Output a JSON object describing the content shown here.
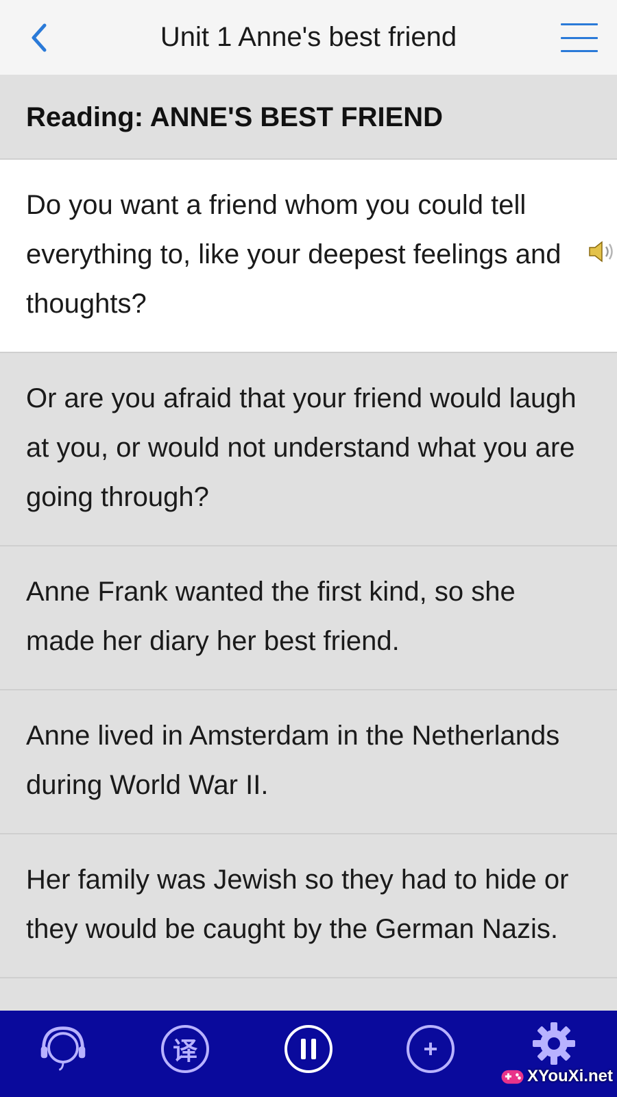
{
  "header": {
    "title": "Unit 1 Anne's best friend",
    "back_icon": "chevron-left-icon",
    "menu_icon": "hamburger-menu-icon",
    "accent_color": "#2a7ad8"
  },
  "section": {
    "heading": "Reading: ANNE'S BEST FRIEND"
  },
  "sentences": [
    {
      "text": "Do you want a friend whom you could tell everything to, like your deepest feelings and thoughts?",
      "active": true
    },
    {
      "text": "Or are you afraid that your friend would laugh at you, or would not understand what you are going through?"
    },
    {
      "text": "Anne Frank wanted the first kind, so she made her diary her best friend."
    },
    {
      "text": "Anne lived in Amsterdam in the Netherlands during World War II."
    },
    {
      "text": "Her family was Jewish so they had to hide or they would be caught by the German Nazis."
    }
  ],
  "bottom_bar": {
    "color": "#0a0a9c",
    "buttons": [
      {
        "name": "headset-icon"
      },
      {
        "name": "translate-icon",
        "label": "译"
      },
      {
        "name": "pause-icon"
      },
      {
        "name": "add-icon",
        "label": "+"
      },
      {
        "name": "gear-icon"
      }
    ]
  },
  "watermark": {
    "text": "XYouXi.net"
  }
}
